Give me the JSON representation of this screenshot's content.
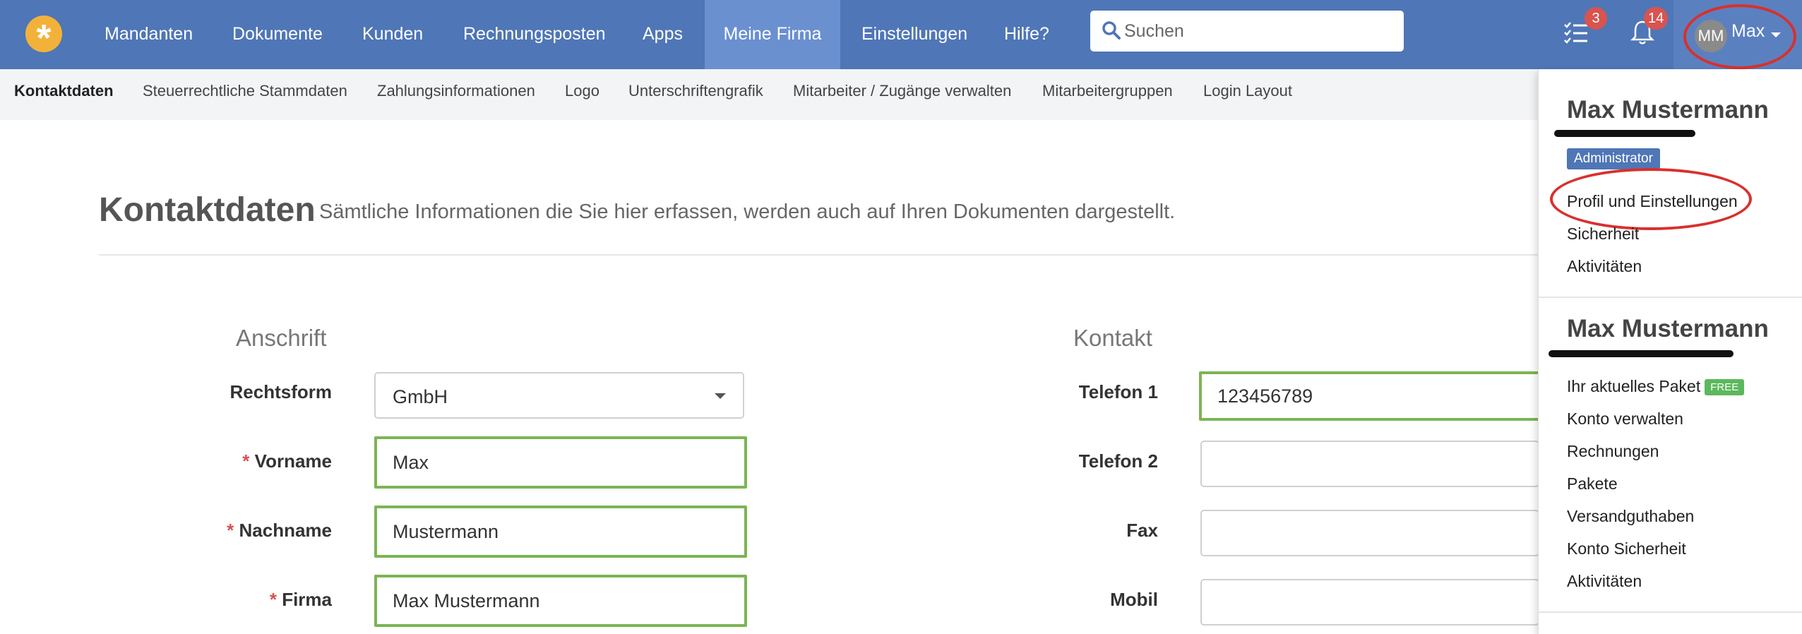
{
  "nav": {
    "items": [
      {
        "label": "Mandanten"
      },
      {
        "label": "Dokumente"
      },
      {
        "label": "Kunden"
      },
      {
        "label": "Rechnungsposten"
      },
      {
        "label": "Apps"
      },
      {
        "label": "Meine Firma"
      },
      {
        "label": "Einstellungen"
      },
      {
        "label": "Hilfe?"
      }
    ],
    "active": "Meine Firma",
    "search_placeholder": "Suchen",
    "tasks_badge": "3",
    "notifications_badge": "14",
    "user_initials": "MM",
    "user_short": "Max"
  },
  "subnav": {
    "items": [
      {
        "label": "Kontaktdaten"
      },
      {
        "label": "Steuerrechtliche Stammdaten"
      },
      {
        "label": "Zahlungsinformationen"
      },
      {
        "label": "Logo"
      },
      {
        "label": "Unterschriftengrafik"
      },
      {
        "label": "Mitarbeiter / Zugänge verwalten"
      },
      {
        "label": "Mitarbeitergruppen"
      },
      {
        "label": "Login Layout"
      }
    ],
    "active": "Kontaktdaten"
  },
  "page": {
    "title": "Kontaktdaten",
    "subtitle": "Sämtliche Informationen die Sie hier erfassen, werden auch auf Ihren Dokumenten dargestellt."
  },
  "address": {
    "heading": "Anschrift",
    "rechtsform_label": "Rechtsform",
    "rechtsform_value": "GmbH",
    "vorname_label": "Vorname",
    "vorname_value": "Max",
    "nachname_label": "Nachname",
    "nachname_value": "Mustermann",
    "firma_label": "Firma",
    "firma_value": "Max Mustermann",
    "required_mark": "*"
  },
  "contact": {
    "heading": "Kontakt",
    "telefon1_label": "Telefon 1",
    "telefon1_value": "123456789",
    "telefon2_label": "Telefon 2",
    "telefon2_value": "",
    "fax_label": "Fax",
    "fax_value": "",
    "mobil_label": "Mobil",
    "mobil_value": ""
  },
  "dropdown": {
    "user_name": "Max Mustermann",
    "role_badge": "Administrator",
    "user_items": [
      {
        "label": "Profil und Einstellungen"
      },
      {
        "label": "Sicherheit"
      },
      {
        "label": "Aktivitäten"
      }
    ],
    "account_name": "Max Mustermann",
    "package_label": "Ihr aktuelles Paket",
    "package_badge": "FREE",
    "account_items": [
      {
        "label": "Konto verwalten"
      },
      {
        "label": "Rechnungen"
      },
      {
        "label": "Pakete"
      },
      {
        "label": "Versandguthaben"
      },
      {
        "label": "Konto Sicherheit"
      },
      {
        "label": "Aktivitäten"
      }
    ]
  },
  "colors": {
    "navbar": "#4f76b6",
    "nav_active": "#6a90d0",
    "highlight_green": "#7cb454",
    "annotation_red": "#d9302c",
    "badge_red": "#d9534f",
    "free_green": "#5cb85c"
  }
}
